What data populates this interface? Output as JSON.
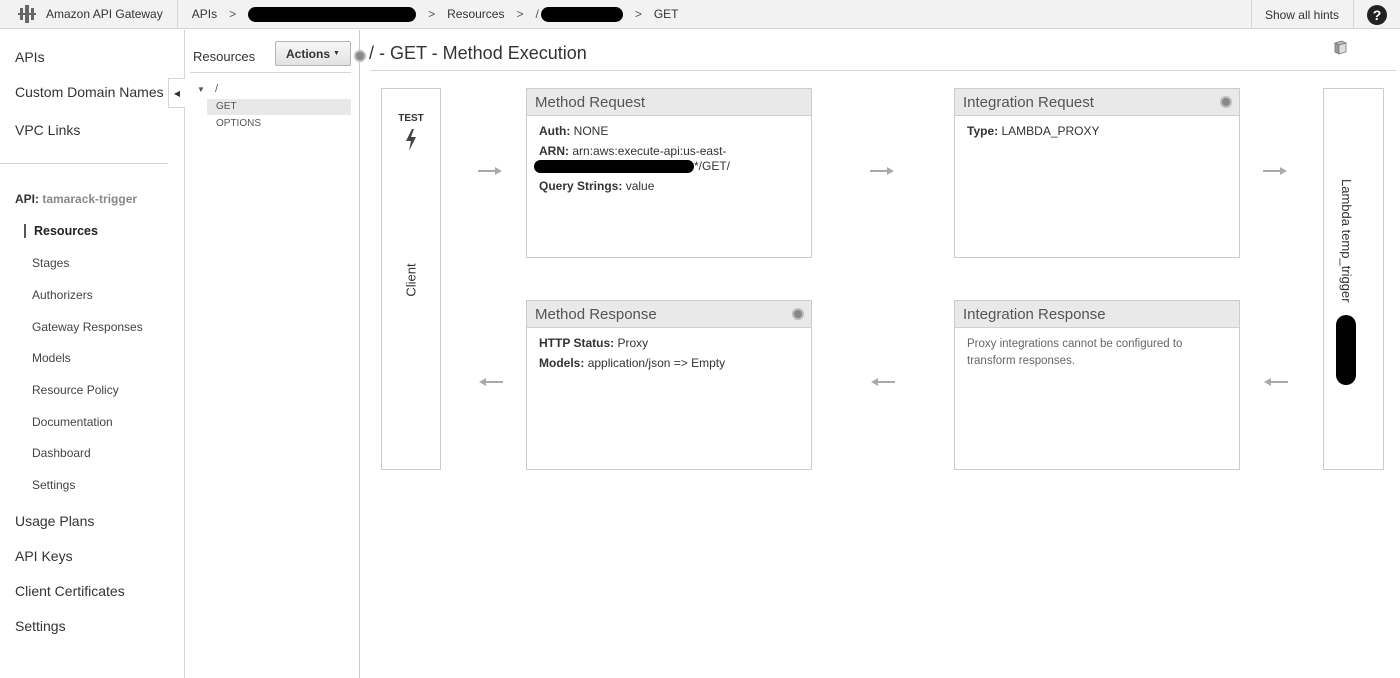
{
  "topbar": {
    "brand": "Amazon API Gateway",
    "crumbs": {
      "apis": "APIs",
      "sep": ">",
      "resources": "Resources",
      "path_prefix": "/",
      "method": "GET"
    },
    "show_hints": "Show all hints",
    "help": "?"
  },
  "leftnav": {
    "main_items": [
      "APIs",
      "Custom Domain Names",
      "VPC Links"
    ],
    "api_prefix": "API:",
    "api_name": "tamarack-trigger",
    "sub_items": [
      "Resources",
      "Stages",
      "Authorizers",
      "Gateway Responses",
      "Models",
      "Resource Policy",
      "Documentation",
      "Dashboard",
      "Settings"
    ],
    "bottom_items": [
      "Usage Plans",
      "API Keys",
      "Client Certificates",
      "Settings"
    ]
  },
  "resources": {
    "title": "Resources",
    "actions": "Actions",
    "root": "/",
    "methods": [
      "GET",
      "OPTIONS"
    ],
    "selected_method": "GET"
  },
  "main": {
    "title": "/ - GET - Method Execution",
    "client": {
      "test": "TEST",
      "label": "Client"
    },
    "method_request": {
      "title": "Method Request",
      "auth_label": "Auth:",
      "auth_value": "NONE",
      "arn_label": "ARN:",
      "arn_value_1": "arn:aws:execute-api:us-east-",
      "arn_value_2": "*/GET/",
      "query_label": "Query Strings:",
      "query_value": "value"
    },
    "integration_request": {
      "title": "Integration Request",
      "type_label": "Type:",
      "type_value": "LAMBDA_PROXY"
    },
    "method_response": {
      "title": "Method Response",
      "status_label": "HTTP Status:",
      "status_value": "Proxy",
      "models_label": "Models:",
      "models_value": "application/json => Empty"
    },
    "integration_response": {
      "title": "Integration Response",
      "note": "Proxy integrations cannot be configured to transform responses."
    },
    "lambda": {
      "label": "Lambda temp_trigger"
    }
  },
  "colors": {
    "border": "#cccccc",
    "header_bg": "#e9e9e9",
    "topbar_bg": "#f2f2f2"
  }
}
